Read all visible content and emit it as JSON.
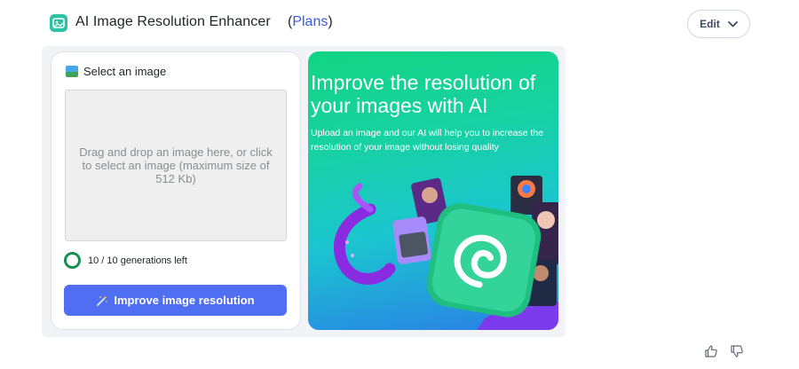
{
  "header": {
    "app_icon": "app-logo-icon",
    "title": "AI Image Resolution Enhancer",
    "plans_open": "(",
    "plans_link": "Plans",
    "plans_close": ")",
    "edit_label": "Edit",
    "edit_icon": "chevron-down-icon"
  },
  "uploader": {
    "label": "Select an image",
    "label_icon": "picture-icon",
    "drop_text": "Drag and drop an image here, or click to select an image (maximum size of 512 Kb)",
    "generations_text": "10 / 10 generations left",
    "generations_used": 0,
    "generations_total": 10,
    "button_label": "Improve image resolution",
    "button_icon": "magic-wand-icon"
  },
  "promo": {
    "title": "Improve the resolution of your images with AI",
    "subtitle": "Upload an image and our AI will help you to increase the resolution of your image without losing quality",
    "art": "promotional illustration: green app tile with white spiral, purple tentacle, portrait cards"
  },
  "feedback": {
    "like_icon": "thumbs-up-icon",
    "dislike_icon": "thumbs-down-icon"
  },
  "colors": {
    "accent": "#4f6ef2",
    "link": "#3b5bdb",
    "brand_green": "#2ec3a4",
    "progress_ring": "#1d8c53",
    "promo_gradient_start": "#12d482",
    "promo_gradient_end": "#2a7ee6"
  }
}
